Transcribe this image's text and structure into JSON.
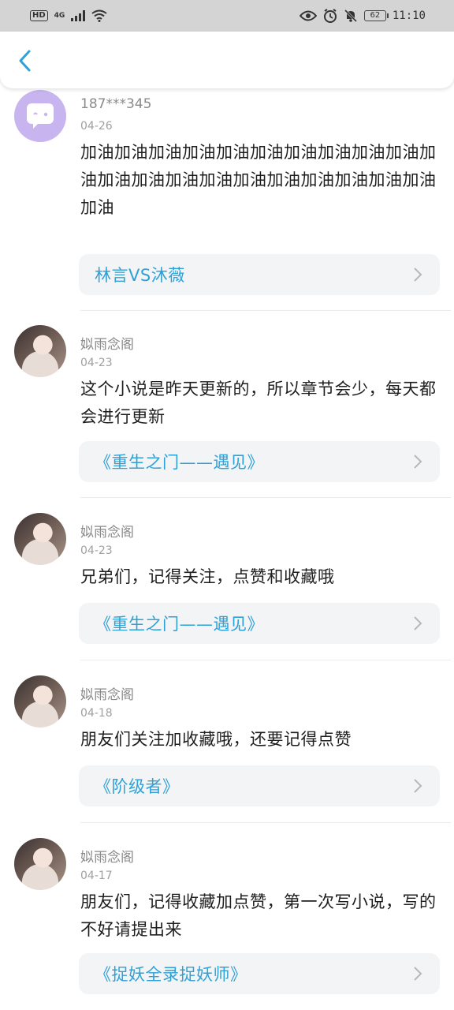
{
  "status_bar": {
    "hd": "HD",
    "network": "4G",
    "battery": "62",
    "time": "11:10"
  },
  "nav": {
    "back_icon": "chevron-left-icon"
  },
  "comments": [
    {
      "username": "187***345",
      "date": "04-26",
      "text": "加油加油加油加油加油加油加油加油加油加油加油加油加油加油加油加油加油加油加油加油加油加油",
      "book": "林言VS沐薇",
      "avatar": "speech-bubble-avatar"
    },
    {
      "username": "姒雨念阁",
      "date": "04-23",
      "text": "这个小说是昨天更新的，所以章节会少，每天都会进行更新",
      "book": "《重生之门——遇见》",
      "avatar": "photo-avatar"
    },
    {
      "username": "姒雨念阁",
      "date": "04-23",
      "text": "兄弟们，记得关注，点赞和收藏哦",
      "book": "《重生之门——遇见》",
      "avatar": "photo-avatar"
    },
    {
      "username": "姒雨念阁",
      "date": "04-18",
      "text": "朋友们关注加收藏哦，还要记得点赞",
      "book": "《阶级者》",
      "avatar": "photo-avatar"
    },
    {
      "username": "姒雨念阁",
      "date": "04-17",
      "text": "朋友们，记得收藏加点赞，第一次写小说，写的不好请提出来",
      "book": "《捉妖全录捉妖师》",
      "avatar": "photo-avatar"
    }
  ],
  "colors": {
    "accent": "#2ea1d6",
    "link_bg": "#f3f4f6",
    "status_bar_bg": "#d4d4d4"
  }
}
